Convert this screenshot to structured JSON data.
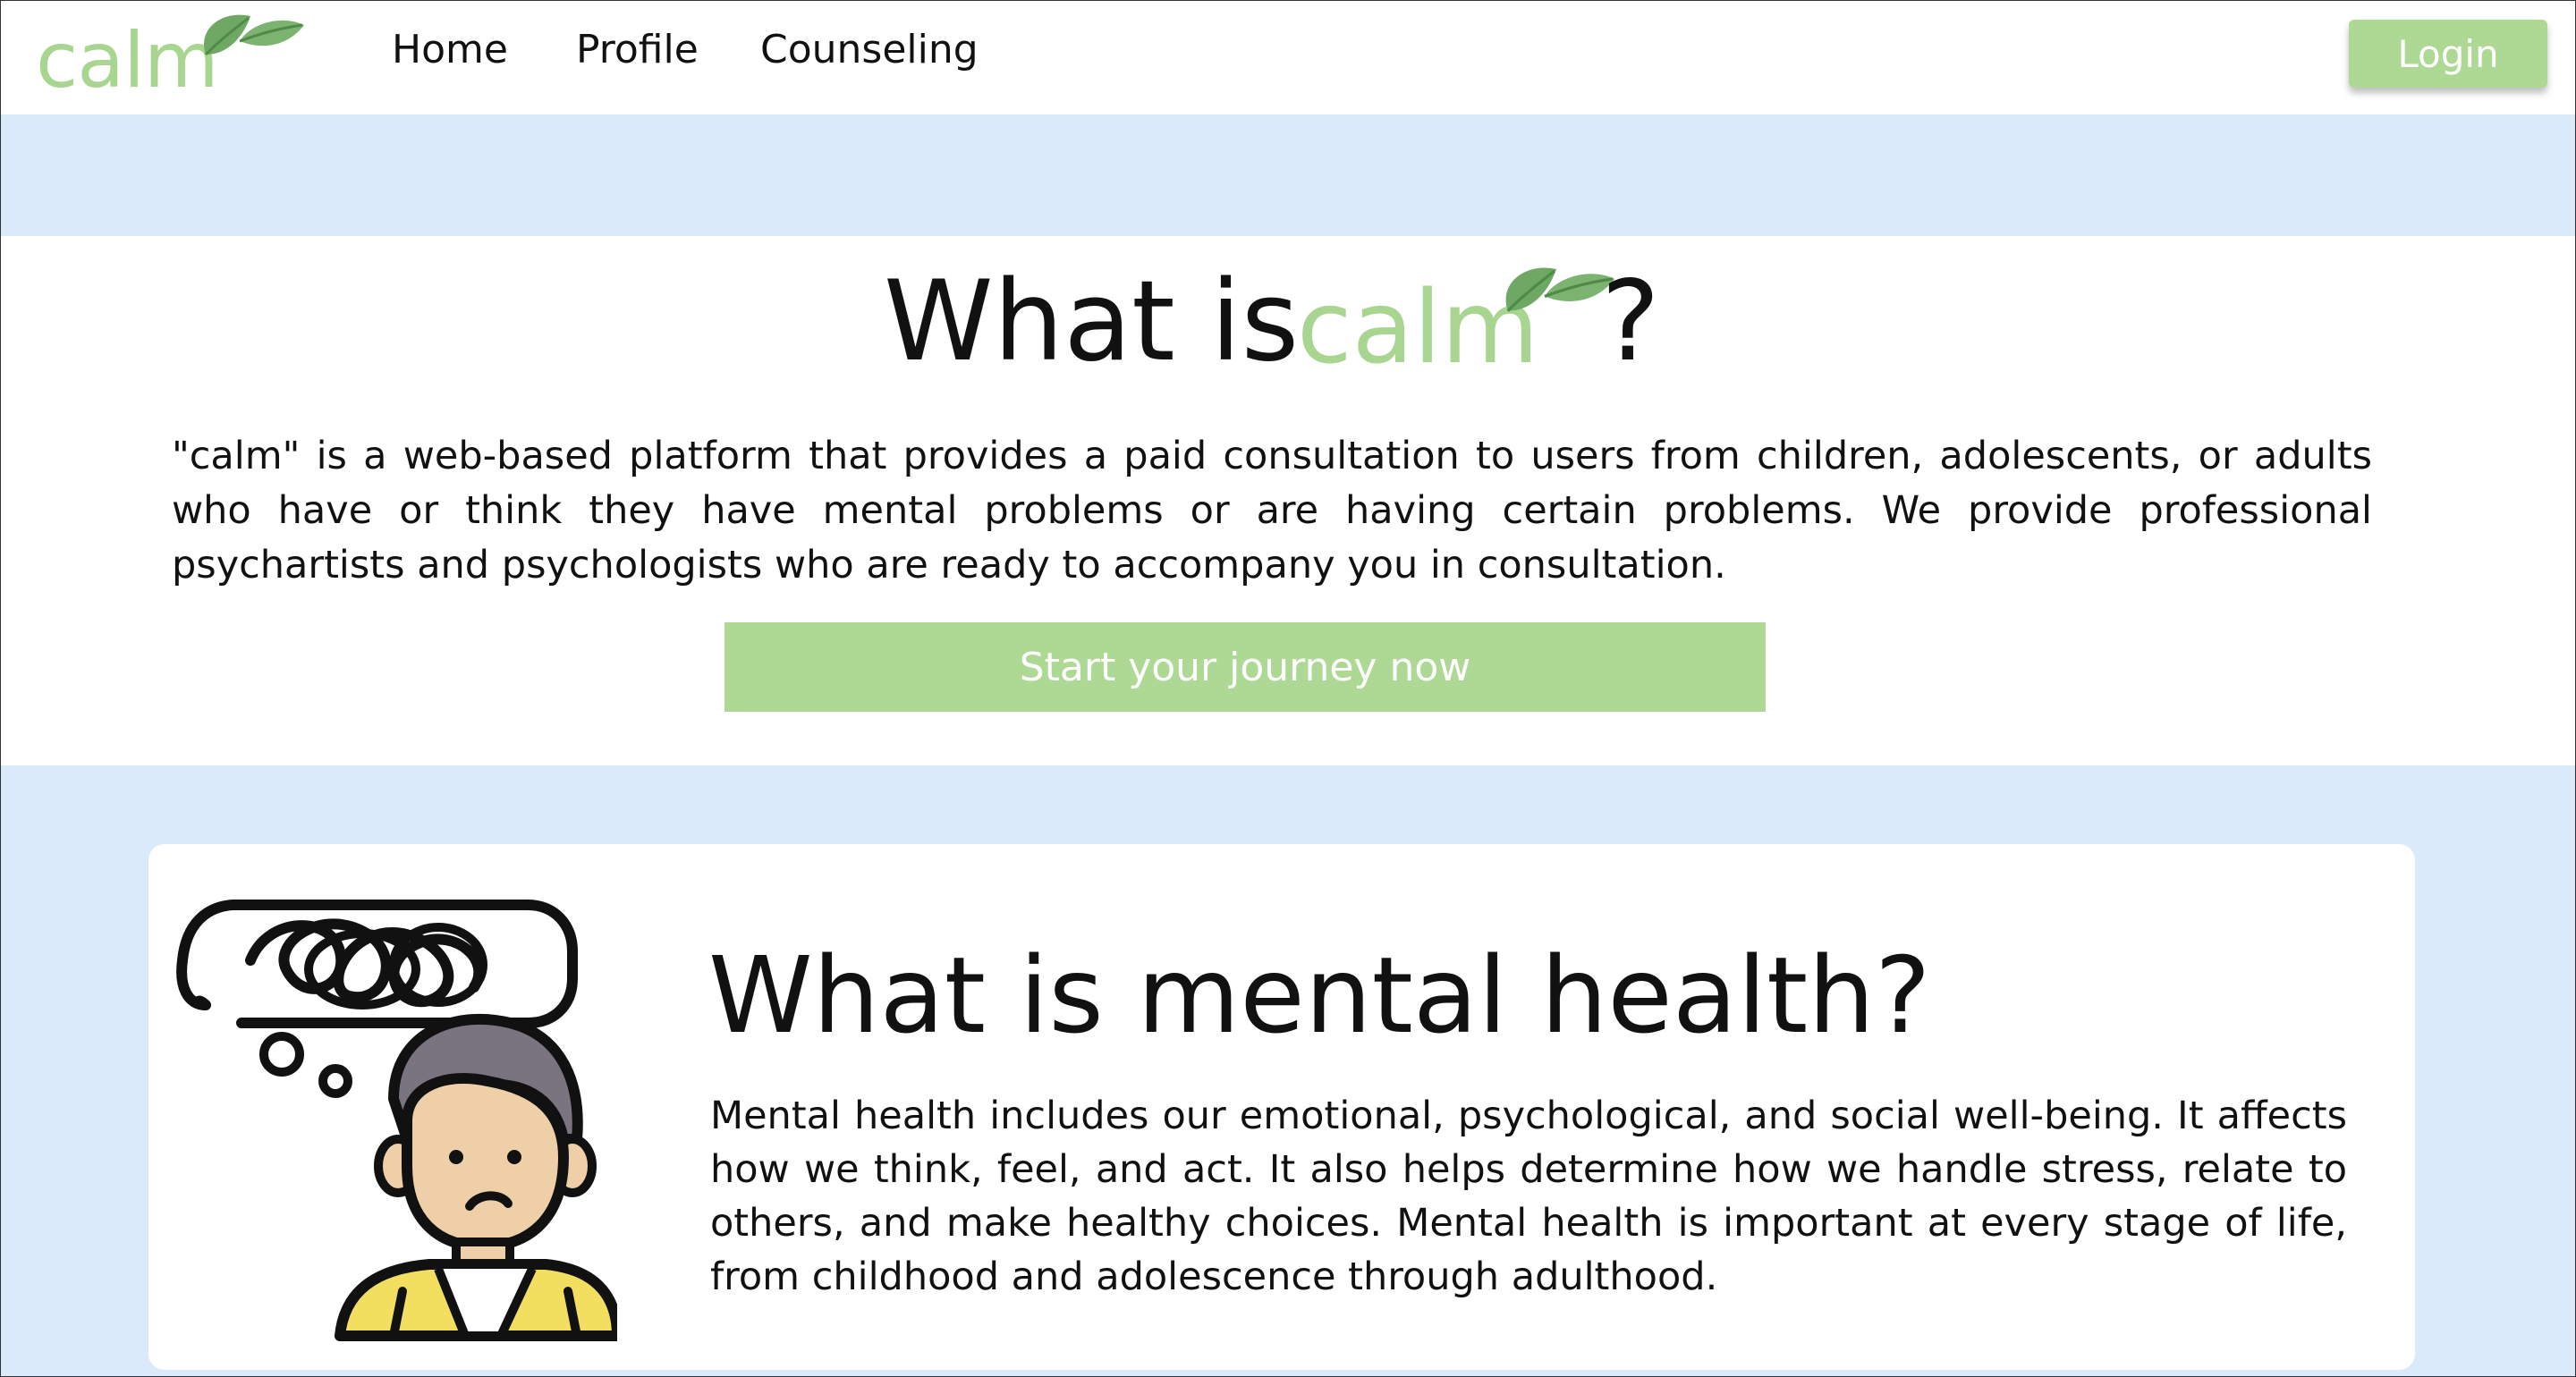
{
  "nav": {
    "brand": "calm",
    "links": [
      "Home",
      "Profile",
      "Counseling"
    ],
    "login_label": "Login"
  },
  "hero": {
    "title_prefix": "What is",
    "title_brand": "calm",
    "title_suffix": "?",
    "description": "\"calm\" is a web-based platform that provides a paid consultation to users  from children, adolescents, or adults who have or think they have mental problems or are having certain problems. We provide professional psychartists and psychologists who are ready to accompany you in consultation.",
    "cta_label": "Start your journey now"
  },
  "mental_health": {
    "title": "What is mental health?",
    "description": "Mental health includes our emotional, psychological, and social well-being. It affects how we think, feel, and act. It also helps determine how we handle stress, relate to others, and make healthy choices. Mental health is important at every stage of life, from childhood and adolescence through adulthood.",
    "illustration_icon": "confused-person-illustration"
  },
  "colors": {
    "brand_green": "#add995",
    "band_blue": "#dbeafa",
    "leaf_green": "#6fa865"
  }
}
